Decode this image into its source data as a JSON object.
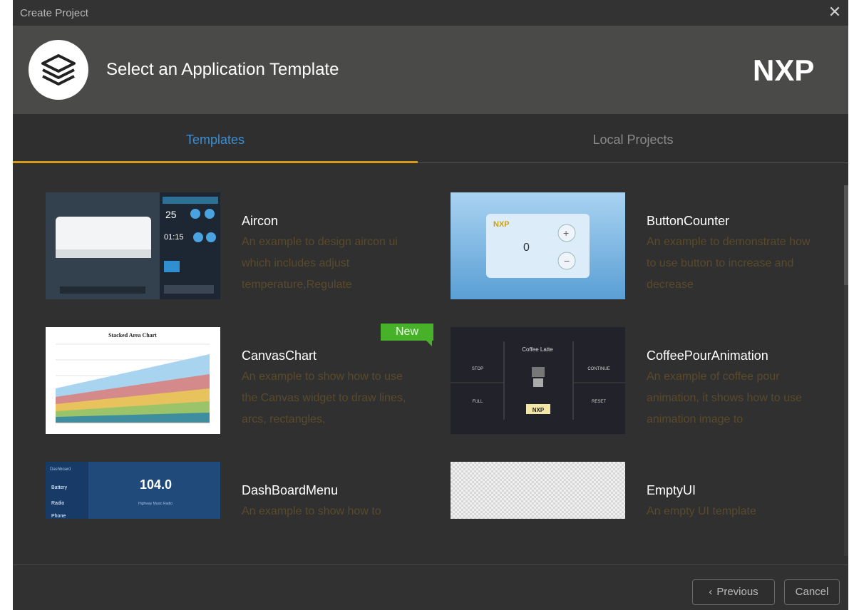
{
  "window": {
    "title": "Create Project"
  },
  "header": {
    "heading": "Select an Application Template",
    "brand": "NXP"
  },
  "tabs": [
    {
      "label": "Templates"
    },
    {
      "label": "Local Projects"
    }
  ],
  "templates": [
    {
      "name": "Aircon",
      "description": "An example to design aircon ui which includes adjust temperature,Regulate"
    },
    {
      "name": "ButtonCounter",
      "description": "An example to demonstrate how to use button to increase and decrease"
    },
    {
      "name": "CanvasChart",
      "description": "An example to show how to use the Canvas widget to draw lines, arcs, rectangles,",
      "badge": "New"
    },
    {
      "name": "CoffeePourAnimation",
      "description": "An example of coffee pour animation, it shows how to use animation image to"
    },
    {
      "name": "DashBoardMenu",
      "description": "An example to show how to"
    },
    {
      "name": "EmptyUI",
      "description": "An empty UI template"
    }
  ],
  "thumbs": {
    "aircon": {
      "temp1": "25",
      "temp2": "01:15"
    },
    "counter": {
      "value": "0",
      "logo": "NXP"
    },
    "chart": {
      "title": "Stacked Area Chart"
    },
    "coffee": {
      "title": "Coffee Latte",
      "stop": "STOP",
      "continue": "CONTINUE",
      "full": "FULL",
      "reset": "RESET",
      "logo": "NXP"
    },
    "dash": {
      "header": "Dashboard",
      "item1": "Battery",
      "item2": "Radio",
      "item3": "Phone",
      "value": "104.0",
      "station": "Highway Music Radio"
    }
  },
  "footer": {
    "previous": "Previous",
    "cancel": "Cancel"
  },
  "colors": {
    "accent_tab": "#3a8fd6",
    "tab_underline": "#d59a1a",
    "badge": "#48b12a",
    "description": "#5a4a2a"
  }
}
